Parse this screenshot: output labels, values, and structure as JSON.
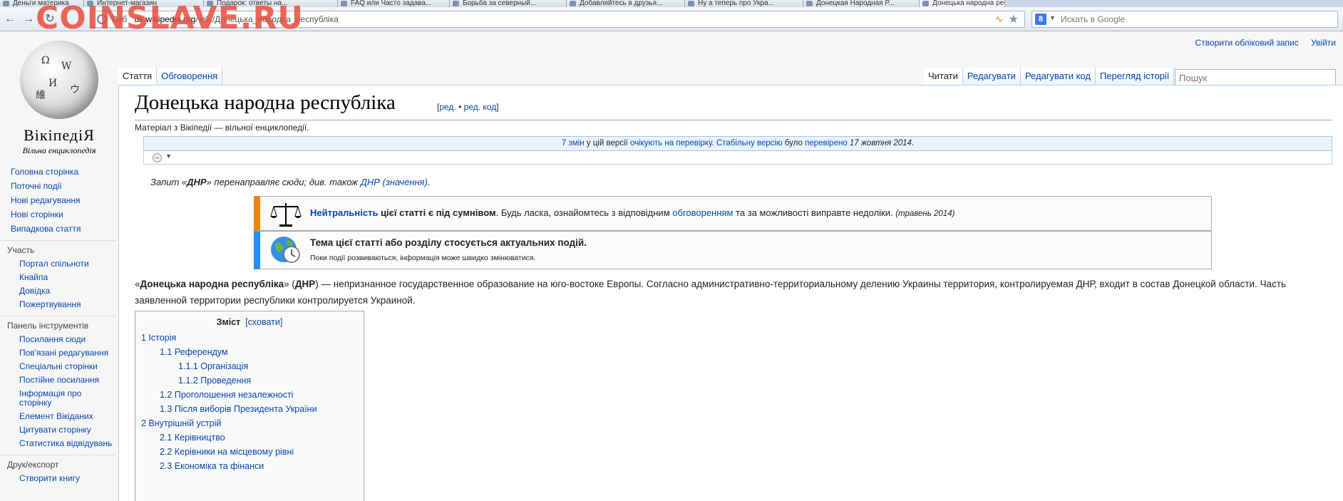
{
  "watermark": "COINSLAVE.RU",
  "browser": {
    "tabs": [
      {
        "label": "Деньги материка"
      },
      {
        "label": "Интернет-магазин"
      },
      {
        "label": "Подарок: ответы на..."
      },
      {
        "label": "FAQ или Часто задава..."
      },
      {
        "label": "Борьба за северный..."
      },
      {
        "label": "Добавляйтесь в друзья..."
      },
      {
        "label": "Ну а теперь про Укра..."
      },
      {
        "label": "Донецкая Народная Р..."
      },
      {
        "label": "Донецька народна рес..."
      }
    ],
    "url_host": "uk.wikipedia.org",
    "url_path": "/wiki/Донецька_народна_республіка",
    "url_prefix": "Веб",
    "search_placeholder": "Искать в Google",
    "search_engine_letter": "8"
  },
  "personal": {
    "create_account": "Створити обліковий запис",
    "login": "Увійти"
  },
  "logo": {
    "wordmark": "ВікіпедіЯ",
    "tagline": "Вільна енциклопедія"
  },
  "sidebar": {
    "main": [
      "Головна сторінка",
      "Поточні події",
      "Нові редагування",
      "Нові сторінки",
      "Випадкова стаття"
    ],
    "participation_head": "Участь",
    "participation": [
      "Портал спільноти",
      "Кнайпа",
      "Довідка",
      "Пожертвування"
    ],
    "tools_head": "Панель інструментів",
    "tools": [
      "Посилання сюди",
      "Пов'язані редагування",
      "Спеціальні сторінки",
      "Постійне посилання",
      "Інформація про сторінку",
      "Елемент Вікіданих",
      "Цитувати сторінку",
      "Статистика відвідувань"
    ],
    "print_head": "Друк/експорт",
    "print": [
      "Створити книгу"
    ]
  },
  "tabs": {
    "article": "Стаття",
    "talk": "Обговорення",
    "read": "Читати",
    "edit": "Редагувати",
    "edit_source": "Редагувати код",
    "history": "Перегляд історії",
    "search_placeholder": "Пошук"
  },
  "article": {
    "title": "Донецька народна республіка",
    "edit_open": "[",
    "edit_link": "ред.",
    "edit_sep": " • ",
    "edit_code_link": "ред. код",
    "edit_close": "]",
    "site_sub": "Матеріал з Вікіпедії — вільної енциклопедії.",
    "flagged": {
      "changes_link": "7 змін",
      "text1": " у цій версії ",
      "pending_link": "очікують на перевірку",
      "text2": ". ",
      "stable_link": "Стабільну версію",
      "text3": " було ",
      "checked_link": "перевірено",
      "date": " 17 жовтня 2014",
      "end": "."
    },
    "hatnote": {
      "pre": "Запит «",
      "bold": "ДНР",
      "mid": "» перенаправляє сюди; див. також ",
      "link": "ДНР (значення)",
      "end": "."
    },
    "ambox1": {
      "link": "Нейтральність",
      "bold": " цієї статті є під сумнівом",
      "text": ". Будь ласка, ознайомтесь з відповідним ",
      "link2": "обговоренням",
      "text2": " та за можливості виправте недоліки. ",
      "date": "(травень 2014)"
    },
    "ambox2": {
      "bold": "Тема цієї статті або розділу стосується актуальних подій.",
      "sub": "Поки події розвиваються, інформація може швидко змінюватися."
    },
    "lead": {
      "open": "«",
      "name": "Донецька народна республіка",
      "mid": "» (",
      "abbr": "ДНР",
      "text": ") — непризнанное государственное образование на юго-востоке Европы. Согласно административно-территориальному делению Украины территория, контролируемая ДНР, входит в состав Донецкой области. Часть заявленной территории республики контролируется Украиной."
    },
    "toc": {
      "title": "Зміст",
      "hide": "[сховати]",
      "items": [
        {
          "level": 1,
          "text": "1 Історія"
        },
        {
          "level": 2,
          "text": "1.1 Референдум"
        },
        {
          "level": 3,
          "text": "1.1.1 Організація"
        },
        {
          "level": 3,
          "text": "1.1.2 Проведення"
        },
        {
          "level": 2,
          "text": "1.2 Проголошення незалежності"
        },
        {
          "level": 2,
          "text": "1.3 Після виборів Президента України"
        },
        {
          "level": 1,
          "text": "2 Внутрішній устрій"
        },
        {
          "level": 2,
          "text": "2.1 Керівництво"
        },
        {
          "level": 2,
          "text": "2.2 Керівники на місцевому рівні"
        },
        {
          "level": 2,
          "text": "2.3 Економіка та фінанси"
        }
      ]
    }
  }
}
